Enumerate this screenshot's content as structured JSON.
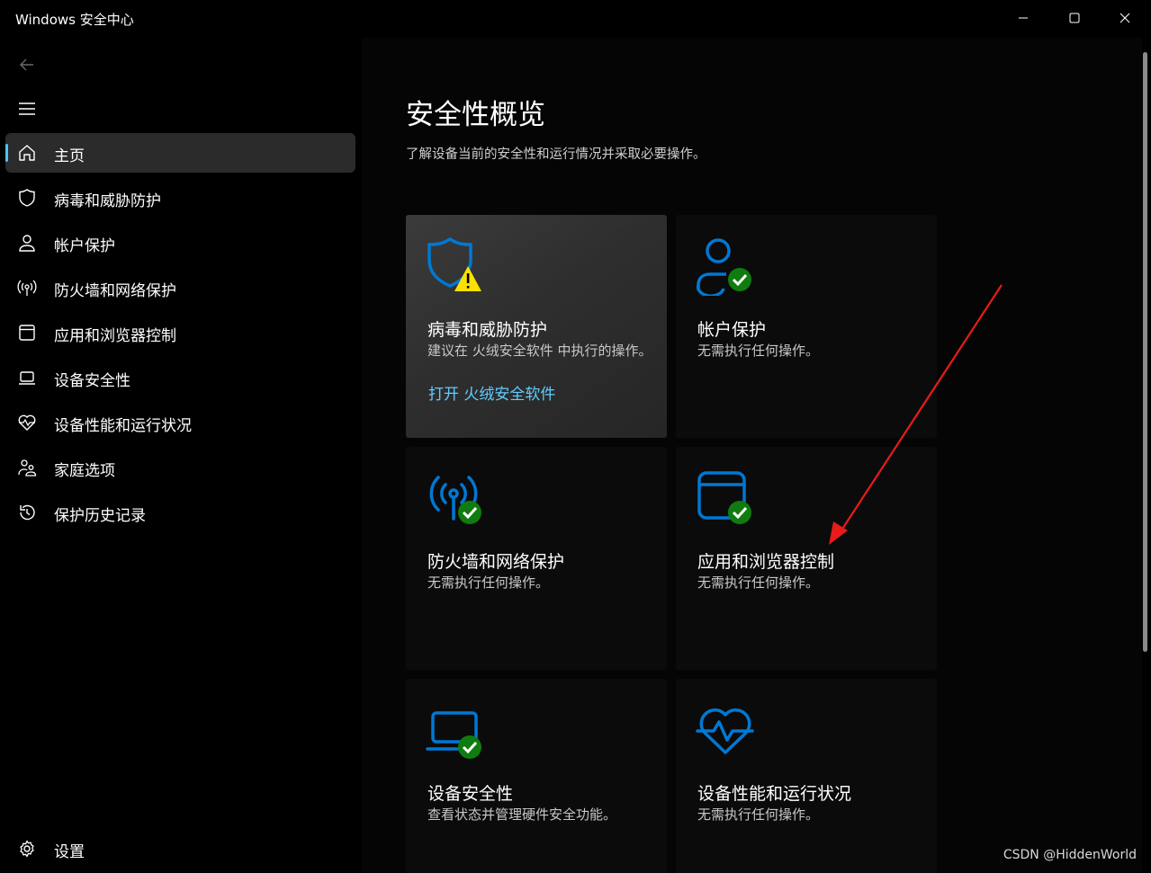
{
  "window": {
    "title": "Windows 安全中心",
    "minimize_icon": "minimize-icon",
    "maximize_icon": "maximize-icon",
    "close_icon": "close-icon"
  },
  "sidebar": {
    "items": [
      {
        "label": "主页",
        "icon": "home-icon",
        "active": true
      },
      {
        "label": "病毒和威胁防护",
        "icon": "shield-icon"
      },
      {
        "label": "帐户保护",
        "icon": "person-icon"
      },
      {
        "label": "防火墙和网络保护",
        "icon": "antenna-icon"
      },
      {
        "label": "应用和浏览器控制",
        "icon": "window-icon"
      },
      {
        "label": "设备安全性",
        "icon": "laptop-icon"
      },
      {
        "label": "设备性能和运行状况",
        "icon": "heartbeat-icon"
      },
      {
        "label": "家庭选项",
        "icon": "family-icon"
      },
      {
        "label": "保护历史记录",
        "icon": "history-icon"
      }
    ],
    "settings_label": "设置"
  },
  "main": {
    "title": "安全性概览",
    "subtitle": "了解设备当前的安全性和运行情况并采取必要操作。",
    "cards": [
      {
        "title": "病毒和威胁防护",
        "desc": "建议在 火绒安全软件 中执行的操作。",
        "link": "打开 火绒安全软件",
        "status": "warning"
      },
      {
        "title": "帐户保护",
        "desc": "无需执行任何操作。",
        "status": "ok"
      },
      {
        "title": "防火墙和网络保护",
        "desc": "无需执行任何操作。",
        "status": "ok"
      },
      {
        "title": "应用和浏览器控制",
        "desc": "无需执行任何操作。",
        "status": "ok"
      },
      {
        "title": "设备安全性",
        "desc": "查看状态并管理硬件安全功能。",
        "status": "ok"
      },
      {
        "title": "设备性能和运行状况",
        "desc": "无需执行任何操作。",
        "status": "none"
      }
    ]
  },
  "watermark": "CSDN @HiddenWorld",
  "colors": {
    "accent": "#0078d4",
    "link": "#60cdff",
    "ok": "#107c10",
    "warning": "#fce100",
    "annotation": "#e81b1b"
  }
}
